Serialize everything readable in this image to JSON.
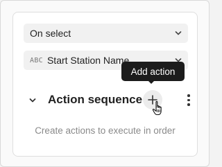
{
  "trigger_select": {
    "value": "On select"
  },
  "field_select": {
    "type_icon": "ABC",
    "value": "Start Station Name"
  },
  "action_sequence": {
    "title": "Action sequence",
    "empty_message": "Create actions to execute in order"
  },
  "tooltip": {
    "label": "Add action"
  },
  "icons": {
    "collapse": "chevron-down-icon",
    "add": "plus-icon",
    "more": "more-vertical-icon",
    "dropdown": "chevron-down-icon",
    "cursor": "hand-pointer-icon"
  }
}
